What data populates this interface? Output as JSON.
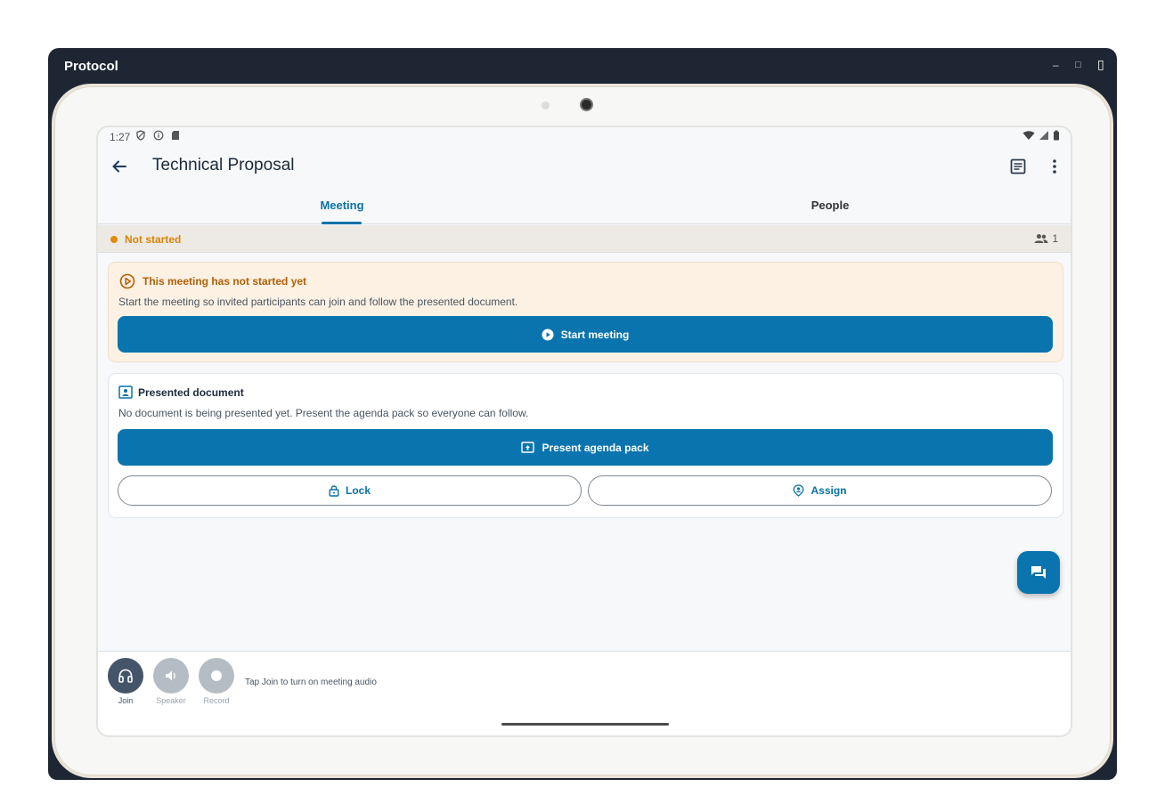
{
  "window": {
    "title": "Protocol",
    "minimize": "–",
    "maximize": "□",
    "device_toggle": "▯"
  },
  "statusbar": {
    "time": "1:27"
  },
  "appbar": {
    "title": "Technical Proposal"
  },
  "tabs": [
    {
      "label": "Meeting",
      "active": true
    },
    {
      "label": "People",
      "active": false
    }
  ],
  "meeting_status": {
    "label": "Not started",
    "participant_count": "1",
    "color": "#e38a06"
  },
  "not_started_card": {
    "title": "This meeting has not started yet",
    "text": "Start the meeting so invited participants can join and follow the presented document.",
    "button_label": "Start meeting"
  },
  "presented_document_card": {
    "title": "Presented document",
    "text": "No document is being presented yet. Present the agenda pack so everyone can follow.",
    "present_button_label": "Present agenda pack",
    "lock_label": "Lock",
    "assign_label": "Assign"
  },
  "audio_controls": {
    "join_label": "Join",
    "speaker_label": "Speaker",
    "record_label": "Record",
    "hint": "Tap Join to turn on meeting audio"
  },
  "colors": {
    "primary": "#0a74ae",
    "warning_bg": "#fdf1e3",
    "warning_text": "#b25e05"
  }
}
